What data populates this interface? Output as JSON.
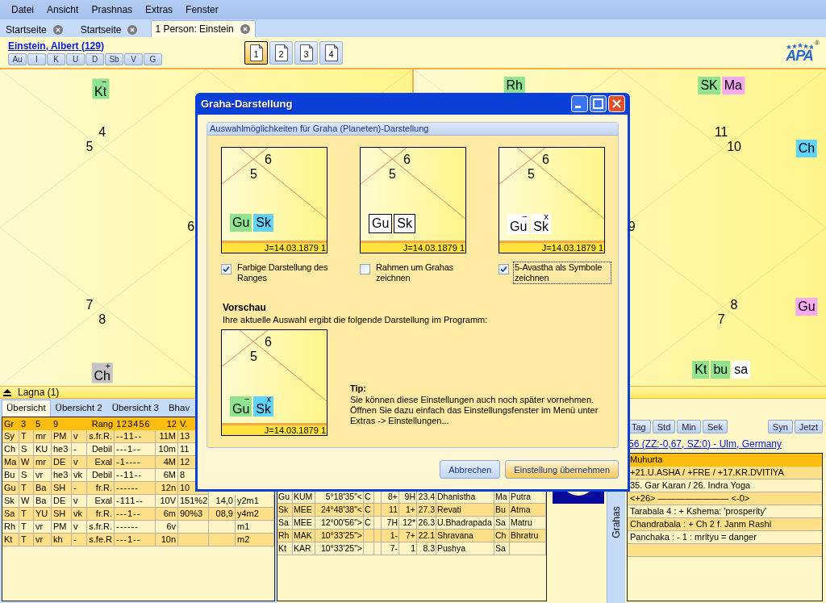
{
  "menu": [
    "Datei",
    "Ansicht",
    "Prashnas",
    "Extras",
    "Fenster"
  ],
  "tabs": [
    {
      "label": "Startseite",
      "selected": false
    },
    {
      "label": "Startseite",
      "selected": false
    },
    {
      "label": "1 Person: Einstein",
      "selected": true
    }
  ],
  "person": {
    "name": "Einstein, Albert (129)",
    "buttons": [
      "Au",
      "I",
      "K",
      "U",
      "D",
      "Sb",
      "V",
      "G"
    ]
  },
  "pages": [
    {
      "label": "1",
      "selected": true
    },
    {
      "label": "2",
      "selected": false
    },
    {
      "label": "3",
      "selected": false
    },
    {
      "label": "4",
      "selected": false
    }
  ],
  "logo": {
    "text": "APA",
    "registered": "®"
  },
  "charts": [
    {
      "numbers": [
        "4",
        "5",
        "6",
        "7",
        "8"
      ],
      "cells": [
        {
          "grahas": [
            {
              "label": "Kt",
              "color": "#90e490",
              "mark": "−"
            }
          ]
        },
        {
          "grahas": [
            {
              "label": "Ch",
              "color": "#c4c4c4",
              "mark": "+"
            }
          ]
        }
      ]
    },
    {
      "numbers": [
        "11",
        "10",
        "9",
        "8",
        "7"
      ],
      "cells": [
        {
          "grahas": [
            {
              "label": "Rh",
              "color": "#90e490"
            }
          ]
        },
        {
          "grahas": [
            {
              "label": "SK",
              "color": "#90e490"
            },
            {
              "label": "Ma",
              "color": "#f6a8f0"
            }
          ]
        },
        {
          "grahas": [
            {
              "label": "Ch",
              "color": "#5fd4f8"
            }
          ]
        },
        {
          "grahas": [
            {
              "label": "Gu",
              "color": "#f6a8f0"
            }
          ]
        },
        {
          "grahas": [
            {
              "label": "Kt",
              "color": "#90e490"
            },
            {
              "label": "bu",
              "color": "#90e490"
            },
            {
              "label": "sa",
              "color": "#ffffff"
            }
          ]
        }
      ]
    }
  ],
  "lagna_bar": {
    "label": "Lagna (1)"
  },
  "bottom_tabs": [
    {
      "label": "Übersicht",
      "selected": true
    },
    {
      "label": "Übersicht 2",
      "selected": false
    },
    {
      "label": "Übersicht 3",
      "selected": false
    },
    {
      "label": "Bhav",
      "selected": false
    }
  ],
  "overview_table": {
    "columns": [
      {
        "text": "Gr"
      },
      {
        "text": "3"
      },
      {
        "text": "5"
      },
      {
        "text": "9"
      },
      {},
      {
        "text": "Rang"
      },
      {
        "text": "123456"
      },
      {
        "text": "12"
      },
      {
        "text": "V."
      }
    ],
    "rows": [
      [
        "Sy",
        "T",
        "mr",
        "PM",
        "v",
        "s.fr.R.",
        "--11--",
        "11M",
        "13"
      ],
      [
        "Ch",
        "S",
        "KU",
        "he3",
        "-",
        "Debil",
        "---1--",
        "10m",
        "11"
      ],
      [
        "Ma",
        "W",
        "mr",
        "DE",
        "v",
        "Exal",
        "-1----",
        "4M",
        "12"
      ],
      [
        "Bu",
        "S",
        "vr",
        "he3",
        "vk",
        "Debil",
        "--11--",
        "6M",
        "8"
      ],
      [
        "Gu",
        "T",
        "Ba",
        "SH",
        "-",
        "fr.R.",
        "------",
        "12n",
        "10"
      ],
      [
        "Sk",
        "W",
        "Ba",
        "DE",
        "v",
        "Exal",
        "-111--",
        "10V",
        "151%2",
        "14,0",
        "y2m1"
      ],
      [
        "Sa",
        "T",
        "YU",
        "SH",
        "vk",
        "fr.R.",
        "---1--",
        "6m",
        "90%3",
        "08,9",
        "y4m2"
      ],
      [
        "Rh",
        "T",
        "vr",
        "PM",
        "v",
        "s.fr.R.",
        "------",
        "6v",
        null,
        null,
        "m1"
      ],
      [
        "Kt",
        "T",
        "vr",
        "kh",
        "-",
        "s.fe.R",
        "---1--",
        "10n",
        null,
        null,
        "m2"
      ]
    ]
  },
  "positions_table": {
    "rows": [
      [
        "Gu",
        "KUM",
        "5°18'35\"<",
        "C",
        null,
        "8+",
        "9H",
        "23.4",
        "Dhanistha",
        "Ma",
        "Putra"
      ],
      [
        "Sk",
        "MEE",
        "24°48'38\"<",
        "C",
        null,
        "11",
        "1+",
        "27.3",
        "Revati",
        "Bu",
        "Atma"
      ],
      [
        "Sa",
        "MEE",
        "12°00'56\">",
        "C",
        null,
        "7H",
        "12*",
        "26.3",
        "U.Bhadrapada",
        "Sa",
        "Matru"
      ],
      [
        "Rh",
        "MAK",
        "10°33'25\">",
        null,
        null,
        "1-",
        "7+",
        "22.1",
        "Shravana",
        "Ch",
        "Bhratru"
      ],
      [
        "Kt",
        "KAR",
        "10°33'25\">",
        null,
        null,
        "7-",
        "1",
        "8.3",
        "Pushya",
        "Sa",
        null
      ]
    ]
  },
  "side_tab": {
    "label": "Grahas"
  },
  "time_buttons": [
    "Tag",
    "Std",
    "Min",
    "Sek"
  ],
  "time_buttons_right": [
    "Syn",
    "Jetzt"
  ],
  "location_link": "56 (ZZ:-0,67, SZ:0) - Ulm, Germany",
  "muhurta": {
    "title": "Muhurta",
    "rows": [
      "+21.U.ASHA / +FRE / +17.KR.DVITIYA",
      "35. Gar Karan  / 26. Indra Yoga",
      "<+26> ———————— <-0>",
      "Tarabala 4 : + Kshema: 'prosperity'",
      "Chandrabala : + Ch 2 f. Janm Rashi",
      "Panchaka : - 1 : mrityu = danger",
      null
    ]
  },
  "dialog": {
    "title": "Graha-Darstellung",
    "group_title": "Auswahlmöglichkeiten für Graha (Planeten)-Darstellung",
    "options": [
      {
        "label": "Farbige Darstellung des Ranges",
        "checked": true,
        "focused": false,
        "preview": {
          "numbers": [
            "5",
            "6"
          ],
          "colored": true,
          "framed": false,
          "symbols": false,
          "footer": "J=14.03.1879 1",
          "grahas": [
            {
              "label": "Gu",
              "color": "#90e490"
            },
            {
              "label": "Sk",
              "color": "#5fd4f8"
            }
          ]
        }
      },
      {
        "label": "Rahmen um Grahas zeichnen",
        "checked": false,
        "focused": false,
        "preview": {
          "numbers": [
            "5",
            "6"
          ],
          "colored": false,
          "framed": true,
          "symbols": false,
          "footer": "J=14.03.1879 1",
          "grahas": [
            {
              "label": "Gu"
            },
            {
              "label": "Sk"
            }
          ]
        }
      },
      {
        "label": "5-Avastha als Symbole zeichnen",
        "checked": true,
        "focused": true,
        "preview": {
          "numbers": [
            "5",
            "6"
          ],
          "colored": false,
          "framed": false,
          "symbols": true,
          "footer": "J=14.03.1879 1",
          "grahas": [
            {
              "label": "Gu",
              "mark": "−"
            },
            {
              "label": "Sk",
              "mark": "x"
            }
          ]
        }
      }
    ],
    "preview_title": "Vorschau",
    "preview_text": "Ihre aktuelle Auswahl ergibt die folgende Darstellung im Programm:",
    "preview": {
      "numbers": [
        "5",
        "6"
      ],
      "colored": true,
      "framed": false,
      "symbols": true,
      "footer": "J=14.03.1879 1",
      "grahas": [
        {
          "label": "Gu",
          "color": "#90e490",
          "mark": "−"
        },
        {
          "label": "Sk",
          "color": "#5fd4f8",
          "mark": "x"
        }
      ]
    },
    "tip_title": "Tip:",
    "tip_lines": [
      "Sie können diese Einstellungen auch noch später vornehmen.",
      "Öffnen Sie dazu einfach das Einstellungsfenster im Menü unter",
      "Extras -> Einstellungen..."
    ],
    "buttons": [
      {
        "label": "Abbrechen",
        "primary": false
      },
      {
        "label": "Einstellung übernehmen",
        "primary": true
      }
    ]
  }
}
